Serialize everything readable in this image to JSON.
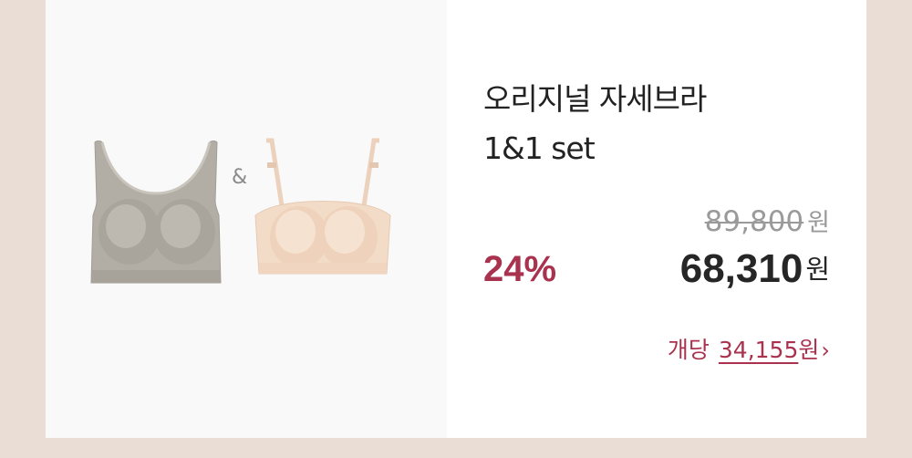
{
  "product": {
    "title": "오리지널 자세브라\n1&1 set",
    "separator": "&",
    "image_alt": [
      "gray bra",
      "beige bra"
    ]
  },
  "pricing": {
    "original_price": "89,800",
    "original_unit": "원",
    "discount": "24%",
    "sale_price": "68,310",
    "sale_unit": "원",
    "per_unit_label": "개당",
    "per_unit_price": "34,155",
    "per_unit_unit": "원",
    "per_unit_chevron": "›"
  },
  "colors": {
    "accent": "#a9334f",
    "background": "#eaddd5",
    "image_panel": "#f9f9f9"
  }
}
